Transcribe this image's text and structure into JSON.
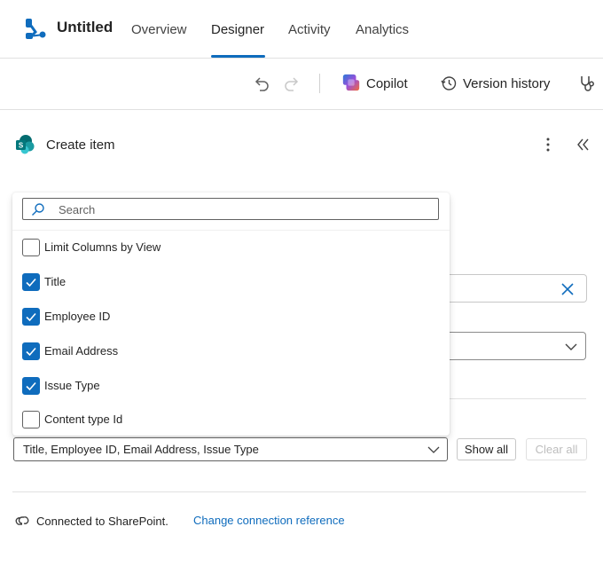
{
  "app": {
    "title": "Untitled",
    "tabs": [
      {
        "label": "Overview"
      },
      {
        "label": "Designer",
        "active": true
      },
      {
        "label": "Activity"
      },
      {
        "label": "Analytics"
      }
    ]
  },
  "toolbar": {
    "undo_icon": "undo-icon",
    "redo_icon": "redo-icon",
    "copilot_label": "Copilot",
    "version_history_label": "Version history",
    "flow_checker_icon": "stethoscope-icon"
  },
  "panel": {
    "title": "Create item",
    "icon": "sharepoint-icon"
  },
  "column_picker": {
    "search_placeholder": "Search",
    "options": [
      {
        "label": "Limit Columns by View",
        "checked": false
      },
      {
        "label": "Title",
        "checked": true
      },
      {
        "label": "Employee ID",
        "checked": true
      },
      {
        "label": "Email Address",
        "checked": true
      },
      {
        "label": "Issue Type",
        "checked": true
      },
      {
        "label": "Content type Id",
        "checked": false
      }
    ],
    "selected_value": "Title, Employee ID, Email Address, Issue Type",
    "show_all_label": "Show all",
    "clear_all_label": "Clear all"
  },
  "connection": {
    "status_text": "Connected to SharePoint.",
    "change_link": "Change connection reference"
  },
  "colors": {
    "accent": "#0f6cbd",
    "text": "#242424"
  }
}
